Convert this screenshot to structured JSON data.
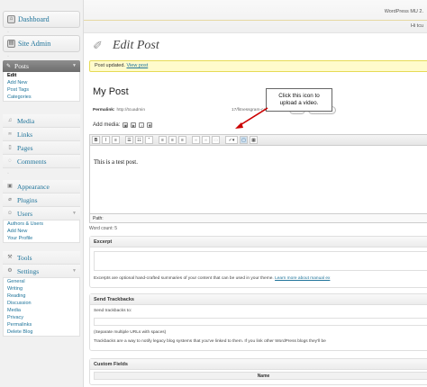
{
  "header": {
    "version": "WordPress MU 2.",
    "howdy": "Hi tcu"
  },
  "sidebar": {
    "dashboard": "Dashboard",
    "site_admin": "Site Admin",
    "posts": {
      "label": "Posts",
      "sub": [
        "Edit",
        "Add New",
        "Post Tags",
        "Categories"
      ]
    },
    "media": "Media",
    "links": "Links",
    "pages": "Pages",
    "comments": "Comments",
    "appearance": "Appearance",
    "plugins": "Plugins",
    "users": {
      "label": "Users",
      "sub": [
        "Authors & Users",
        "Add New",
        "Your Profile"
      ]
    },
    "tools": "Tools",
    "settings": {
      "label": "Settings",
      "sub": [
        "General",
        "Writing",
        "Reading",
        "Discussion",
        "Media",
        "Privacy",
        "Permalinks",
        "Delete Blog"
      ]
    }
  },
  "page": {
    "title": "Edit Post",
    "notice_text": "Post updated.",
    "notice_link": "View post",
    "post_title": "My Post",
    "permalink_label": "Permalink:",
    "permalink_url": "http://tcuadmin",
    "permalink_slug": "17/fitnessgram-components/",
    "edit_btn": "Edit",
    "view_post_btn": "View Post",
    "add_media_label": "Add media:",
    "editor_content": "This is a test post.",
    "path_label": "Path:",
    "word_count": "Word count: 5"
  },
  "callout": {
    "line1": "Click this icon to",
    "line2": "upload a video."
  },
  "excerpt": {
    "title": "Excerpt",
    "help": "Excerpts are optional hand-crafted summaries of your content that can be used in your theme.",
    "help_link": "Learn more about manual ex"
  },
  "trackbacks": {
    "title": "Send Trackbacks",
    "label": "Send trackbacks to:",
    "hint": "(Separate multiple URLs with spaces)",
    "help": "Trackbacks are a way to notify legacy blog systems that you've linked to them. If you link other WordPress blogs they'll be"
  },
  "custom_fields": {
    "title": "Custom Fields",
    "col_name": "Name"
  },
  "colors": {
    "link": "#21759b",
    "notice_bg": "#fffbcc",
    "callout_arrow": "#cc0000"
  }
}
